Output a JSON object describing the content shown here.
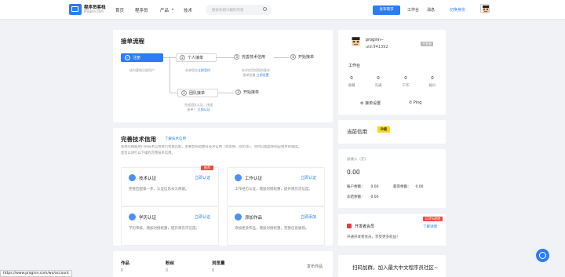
{
  "nav": {
    "logo_name": "程序员客栈",
    "logo_sub": "Proginn.com",
    "links": [
      "首页",
      "程序员",
      "产品",
      "技术"
    ],
    "search_placeholder": "搜索你想兴趣的内容",
    "publish": "发布需求",
    "work": "工作台",
    "messages": "消息",
    "switch": "切换身份"
  },
  "process": {
    "title": "接单流程",
    "step1": {
      "num": "1",
      "label": "注册",
      "desc": "成为客栈注册用户"
    },
    "step2": {
      "num": "2",
      "label": "个人接单",
      "desc_prefix": "未来您在",
      "desc_link": "立即签约"
    },
    "step3": {
      "num": "3",
      "label": "完善技术信用",
      "desc_l1": "技术信用如您的基本",
      "desc_l2": "接单权重",
      "desc_link": "立即设置"
    },
    "step4": {
      "num": "4",
      "label": "开始接单"
    },
    "step2b": {
      "num": "2",
      "label": "团队接单",
      "desc_l1": "完成团队认证，快速",
      "desc_l2": "接单！",
      "desc_link": "立即认证"
    },
    "step3b": {
      "num": "3",
      "label": "开始接单"
    }
  },
  "credit": {
    "title": "完善技术信用",
    "learn": "了解技术信用",
    "intro_l1": "客栈可根据用户的技术信用进行智能匹配，主要影响因素有技术信用（如案例、简历等）、项目匹配度和响应接单的速度。",
    "intro_l2": "您可以进行以下操作完善技术信用。",
    "items": [
      {
        "title": "技术认证",
        "action": "立即认证",
        "badge": "推荐",
        "desc": "完善匹配第一步，认证信息永久保留。"
      },
      {
        "title": "工作认证",
        "action": "立即认证",
        "desc": "工作经历认证，增加对接权重，提升简历可信度。"
      },
      {
        "title": "学历认证",
        "action": "立即认证",
        "desc": "学历审核，增加对接权重，提升简历可信度。"
      },
      {
        "title": "添加作品",
        "action": "立即添加",
        "desc": "添加更多作品，增加对接权重，完善信息展现。"
      }
    ]
  },
  "works": {
    "cols": [
      {
        "label": "作品",
        "value": "0"
      },
      {
        "label": "粉丝",
        "value": "0"
      },
      {
        "label": "浏览量",
        "value": "0"
      }
    ],
    "publish": "发布作品"
  },
  "profile": {
    "name": "proginn--",
    "uid": "uid:941392",
    "tag": "开发者",
    "workbench": "工作台",
    "stats": [
      {
        "value": "0",
        "label": "收藏"
      },
      {
        "value": "0",
        "label": "沟通"
      },
      {
        "value": "0",
        "label": "工作"
      },
      {
        "value": "0",
        "label": "报价"
      }
    ],
    "settings": "接单设置",
    "ping": "Ping"
  },
  "level": {
    "label": "当前信用",
    "badge": "D级"
  },
  "balance": {
    "title": "总收入（元）",
    "total": "0.00",
    "account_label": "账户余额：",
    "account": "0.00",
    "freeze_label": "冻结余额：",
    "freeze": "0.00",
    "income_label": "薪资余额：",
    "income": "0.00"
  },
  "vip": {
    "corner": "120%递增",
    "title": "开发者会员",
    "link": "了解详情",
    "desc": "开通开发者会员，享受更多权益！"
  },
  "community": "扫码加群，加入最大中文程序员社区~",
  "status_url": "https://www.proginn.com/wo/account",
  "colors": {
    "accent": "#2b7cf6",
    "badge": "#ffd21c",
    "vip_corner": "#f04a3e"
  }
}
